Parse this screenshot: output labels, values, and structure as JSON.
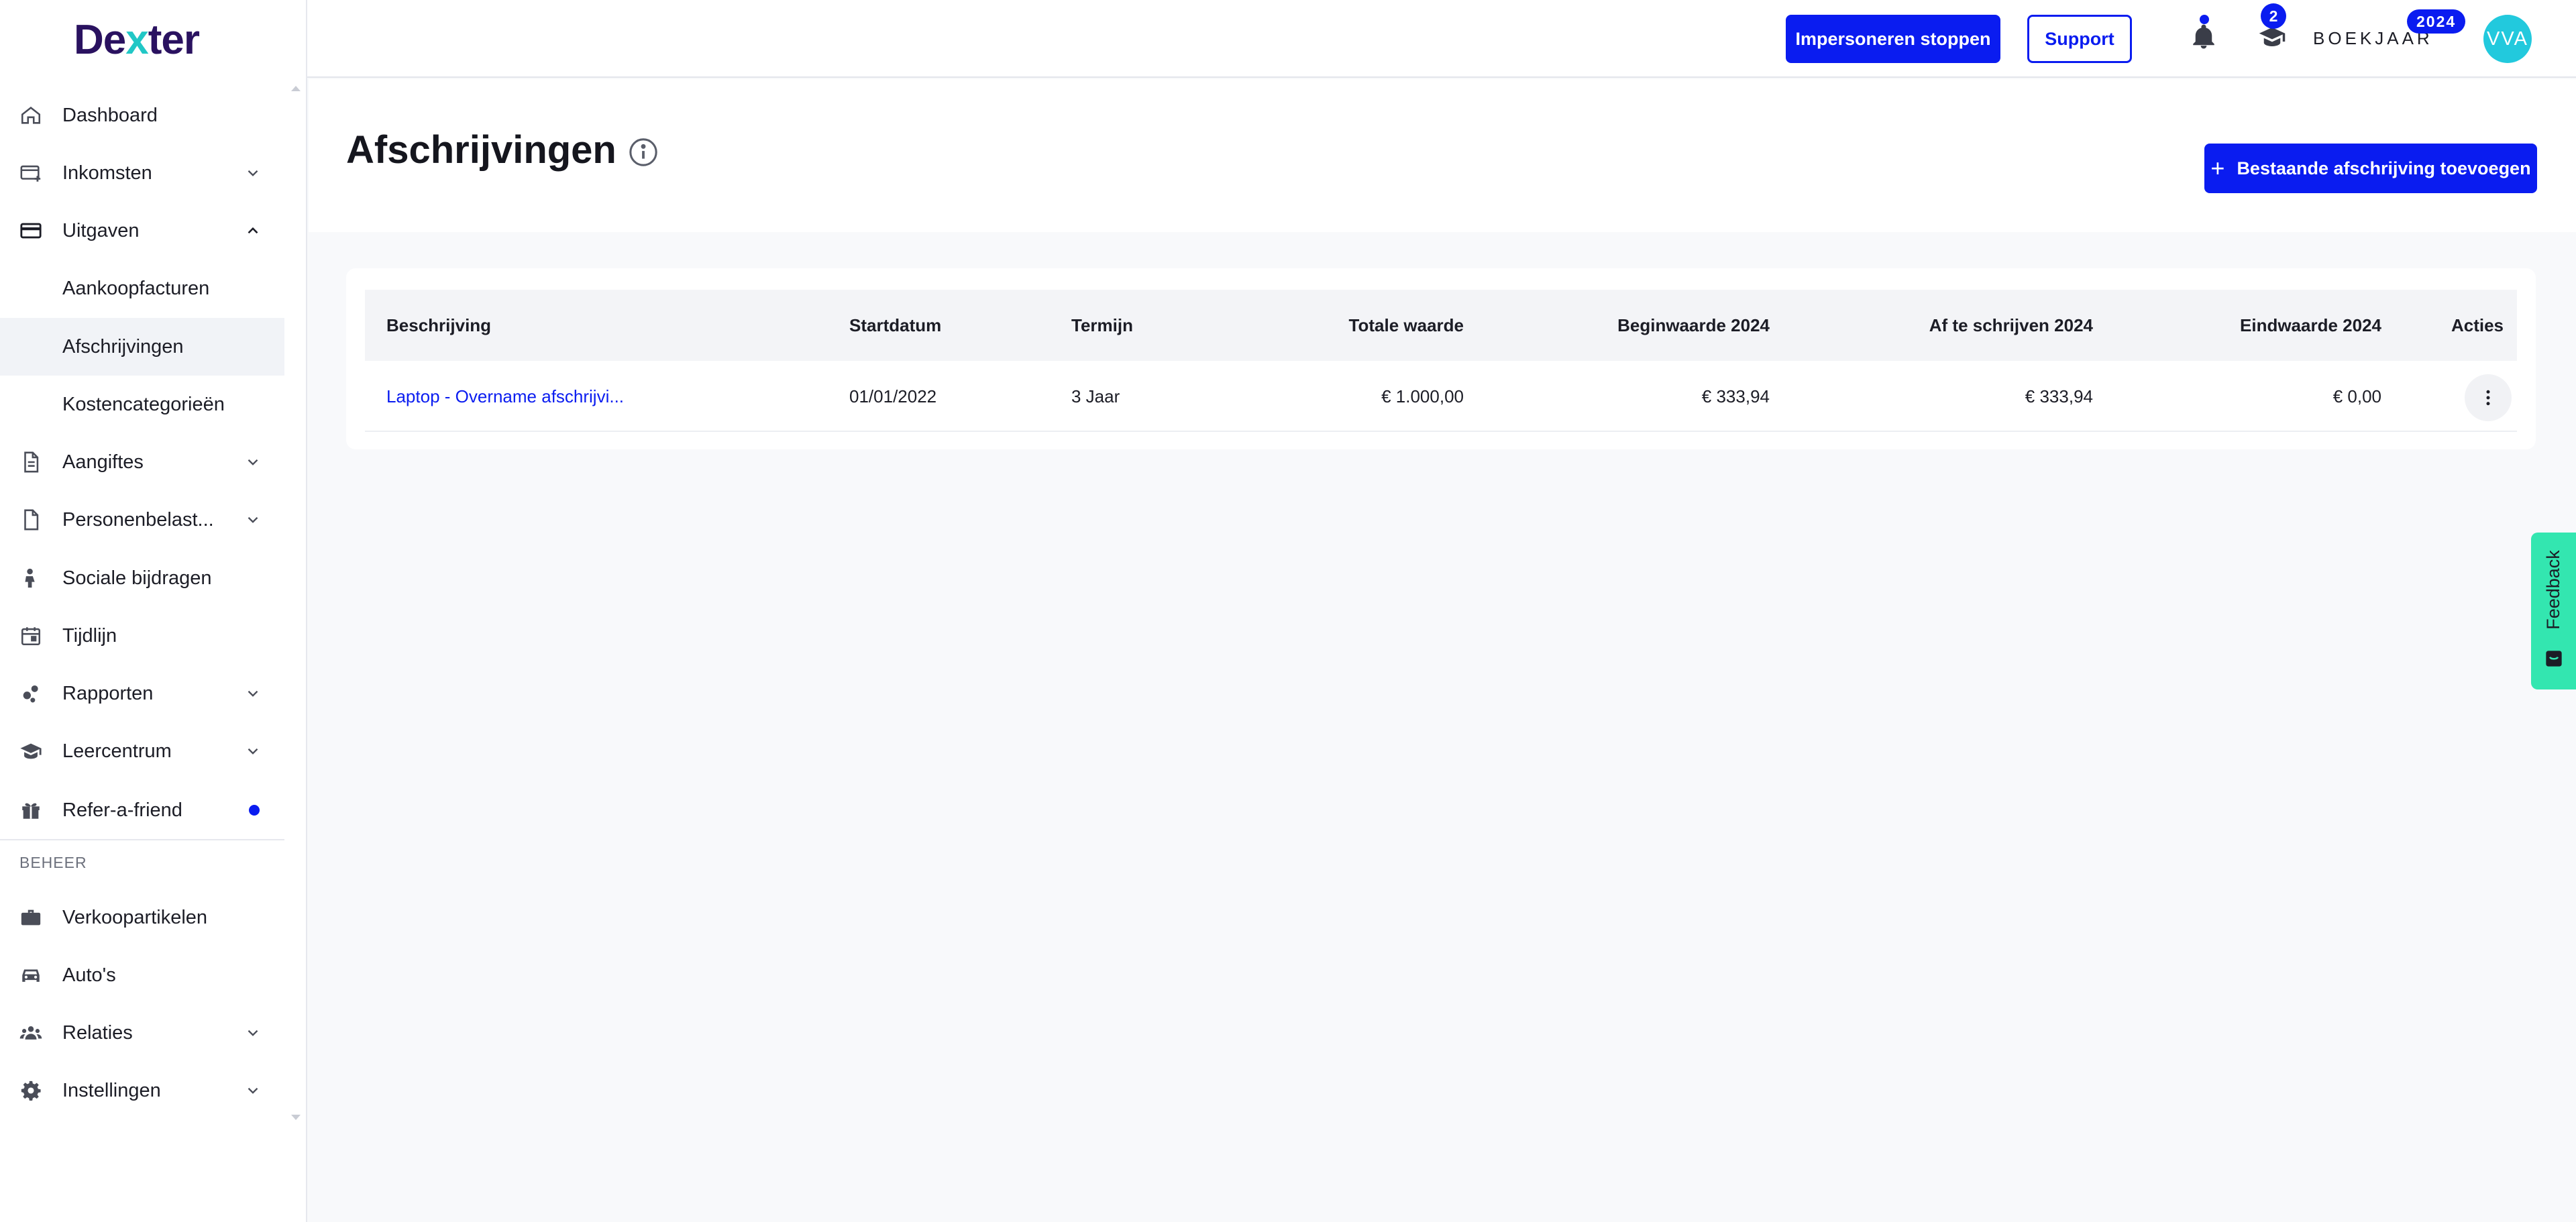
{
  "app": {
    "logo_text_pre": "De",
    "logo_text_x": "x",
    "logo_text_post": "ter"
  },
  "sidebar": {
    "items": [
      {
        "label": "Dashboard",
        "icon": "home-icon"
      },
      {
        "label": "Inkomsten",
        "icon": "income-icon"
      },
      {
        "label": "Uitgaven",
        "icon": "credit-card-icon"
      },
      {
        "label": "Aankoopfacturen"
      },
      {
        "label": "Afschrijvingen"
      },
      {
        "label": "Kostencategorieën"
      },
      {
        "label": "Aangiftes",
        "icon": "document-icon"
      },
      {
        "label": "Personenbelast...",
        "icon": "file-icon"
      },
      {
        "label": "Sociale bijdragen",
        "icon": "person-icon"
      },
      {
        "label": "Tijdlijn",
        "icon": "calendar-icon"
      },
      {
        "label": "Rapporten",
        "icon": "chart-dots-icon"
      },
      {
        "label": "Leercentrum",
        "icon": "graduation-cap-icon"
      },
      {
        "label": "Refer-a-friend",
        "icon": "gift-icon"
      }
    ],
    "section_title": "BEHEER",
    "manage_items": [
      {
        "label": "Verkoopartikelen",
        "icon": "briefcase-icon"
      },
      {
        "label": "Auto's",
        "icon": "car-icon"
      },
      {
        "label": "Relaties",
        "icon": "people-icon"
      },
      {
        "label": "Instellingen",
        "icon": "gear-icon"
      }
    ]
  },
  "topbar": {
    "impersonate_label": "Impersoneren stoppen",
    "support_label": "Support",
    "learn_count": "2",
    "year_label": "BOEKJAAR",
    "year_value": "2024",
    "avatar_initials": "VVA"
  },
  "page": {
    "title": "Afschrijvingen",
    "add_button_label": "Bestaande afschrijving toevoegen"
  },
  "table": {
    "columns": [
      "Beschrijving",
      "Startdatum",
      "Termijn",
      "Totale waarde",
      "Beginwaarde 2024",
      "Af te schrijven 2024",
      "Eindwaarde 2024",
      "Acties"
    ],
    "rows": [
      {
        "description": "Laptop - Overname afschrijvi...",
        "start_date": "01/01/2022",
        "term": "3 Jaar",
        "total_value": "€ 1.000,00",
        "begin_value": "€ 333,94",
        "to_depreciate": "€ 333,94",
        "end_value": "€ 0,00"
      }
    ]
  },
  "feedback": {
    "label": "Feedback"
  },
  "colors": {
    "primary": "#0a1cf0",
    "brand": "#2a1260",
    "accent": "#21c7c6",
    "feedback": "#33e6b0",
    "avatar": "#22c9dd"
  }
}
